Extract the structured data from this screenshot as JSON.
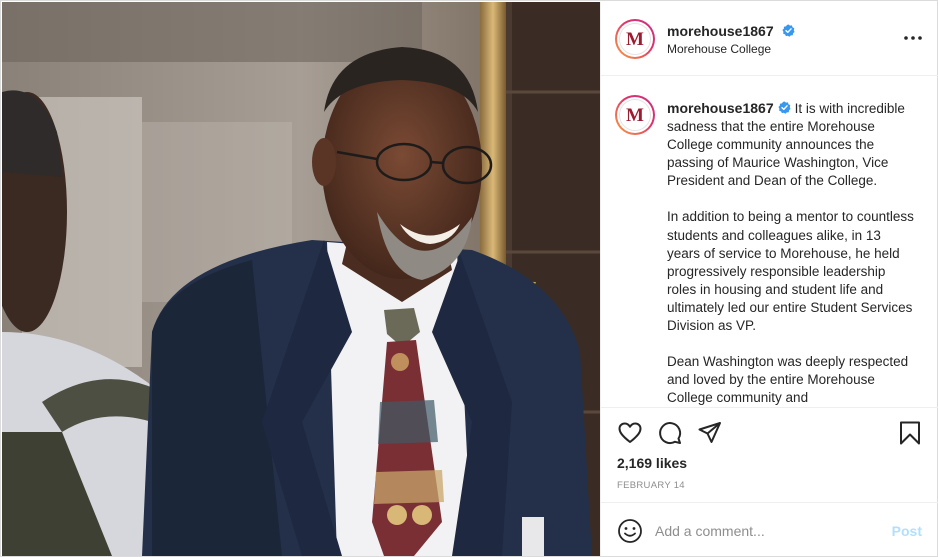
{
  "post": {
    "header": {
      "username": "morehouse1867",
      "subtitle": "Morehouse College",
      "avatar_letter": "M",
      "more_icon": "more-horizontal-icon"
    },
    "caption": {
      "username": "morehouse1867",
      "paragraphs": [
        "It is with incredible sadness that the entire Morehouse College community announces the passing of Maurice Washington, Vice President and Dean of the College.",
        "In addition to being a mentor to countless students and colleagues alike, in 13 years of service to Morehouse, he held progressively responsible leadership roles in housing and student life and ultimately led our entire Student Services Division as VP.",
        "Dean Washington was deeply respected and loved by the entire Morehouse College community and"
      ]
    },
    "actions": {
      "icons": [
        "heart-icon",
        "comment-icon",
        "share-icon",
        "bookmark-icon"
      ],
      "likes": "2,169 likes",
      "date": "FEBRUARY 14"
    },
    "comment": {
      "placeholder": "Add a comment...",
      "post_label": "Post",
      "emoji_icon": "smiley-icon"
    },
    "colors": {
      "verified": "#3897f0",
      "brand_maroon": "#9b1b30",
      "post_disabled": "#b2dffc",
      "muted": "#8e8e8e"
    }
  }
}
